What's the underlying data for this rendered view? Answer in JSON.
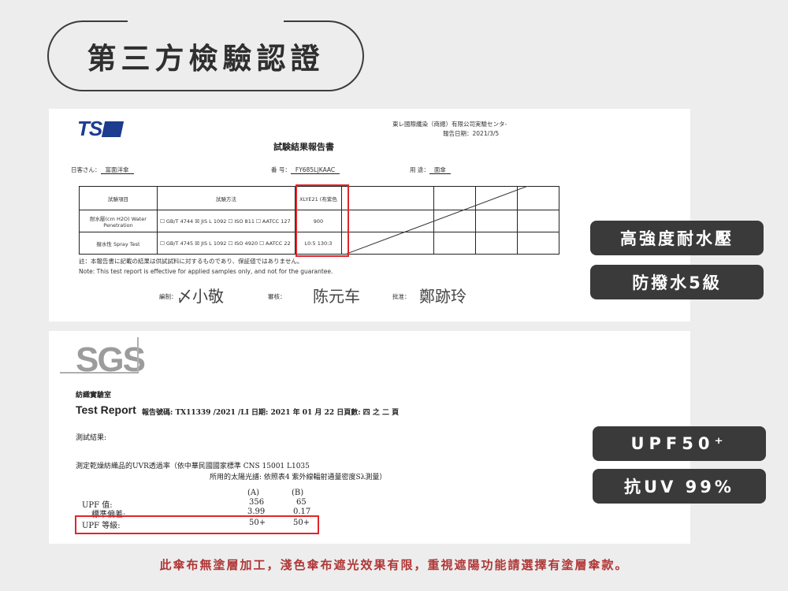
{
  "header": {
    "title": "第三方檢驗認證"
  },
  "tsi": {
    "logo": "TS",
    "company_line": "東レ國際纖染（商總）有限公司実驗センタ-",
    "date_line": "報告日期：2021/3/5",
    "report_title": "試験結果報告書",
    "client_label": "日客さん：",
    "client_value": "富面洋傘",
    "number_label": "番 号：",
    "number_value": "FY685L|KAAC",
    "use_label": "用 途：",
    "use_value": "面傘",
    "table": {
      "col_item": "試験項目",
      "col_method": "試験方法",
      "col_sample": "XLYE21 (布紫色",
      "row1_item": "耐水壓(cm H2O) Water Penetration",
      "row1_method": "☐ GB/T 4744 ☒ JIS L 1092 ☐ ISO 811 ☐ AATCC 127",
      "row1_value": "900",
      "row2_item": "撥水性 Spray Test",
      "row2_method": "☐ GB/T 4745 ☒ JIS L 1092 ☐ ISO 4920 ☐ AATCC 22",
      "row2_value": "L0:5 130:3"
    },
    "note_jp": "註：本報告書に記載の結果は供試試料に対するものであり、保証値ではありません。",
    "note_en": "Note: This test report is effective for applied samples only, and not for the guarantee.",
    "sig_label_1": "編制：",
    "sig_label_2": "審核：",
    "sig_label_3": "批准："
  },
  "sgs": {
    "logo": "SGS",
    "lab": "紡織實驗室",
    "test_report": "Test Report",
    "report_no_line": "報告號碼: TX11339 /2021 /LI 日期: 2021 年 01 月 22 日頁數: 四 之 二 頁",
    "result_label": "測試結果:",
    "method_line1": "測定乾燥紡織品的UVR透過率（依中華民國國家標準 CNS 15001 L1035",
    "method_line2": "所用的太陽光譜: 依照表4 紫外線輻射通量密度Sλ測量）",
    "col_a": "(A)",
    "col_b": "(B)",
    "upf_label": "UPF 值:",
    "upf_a": "356",
    "upf_b": "65",
    "std_label": "標準偏差:",
    "std_a": "3.99",
    "std_b": "0.17",
    "grade_label": "UPF 等級:",
    "grade_a": "50+",
    "grade_b": "50+"
  },
  "badges": {
    "water_pressure": "高強度耐水壓",
    "water_repellent": "防撥水5級",
    "upf": "UPF50⁺",
    "uv": "抗UV 99%"
  },
  "footer": "此傘布無塗層加工，淺色傘布遮光效果有限，重視遮陽功能請選擇有塗層傘款。"
}
